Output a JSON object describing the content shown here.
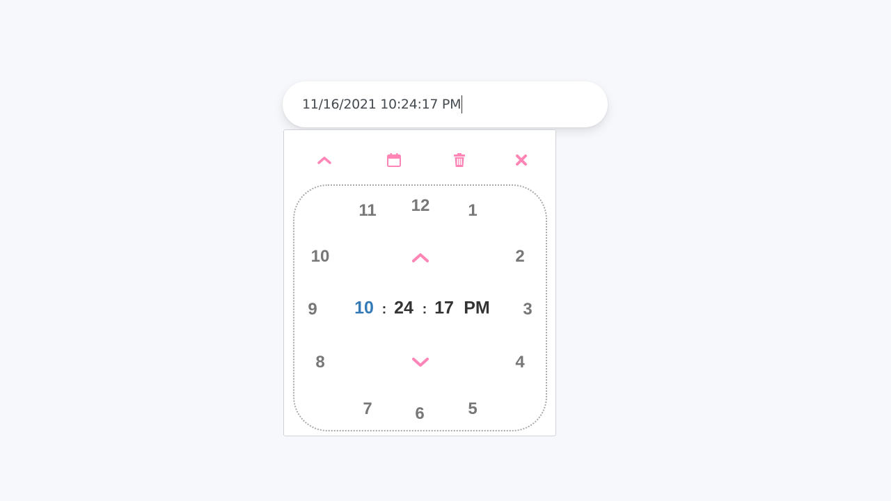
{
  "input": {
    "value": "11/16/2021 10:24:17 PM"
  },
  "colors": {
    "accent": "#ff85b6",
    "selected": "#337ab7",
    "hour_text": "#777777",
    "time_text": "#333333"
  },
  "toolbar": {
    "items": [
      {
        "icon": "chevron-up-icon"
      },
      {
        "icon": "calendar-icon"
      },
      {
        "icon": "trash-icon"
      },
      {
        "icon": "close-icon"
      }
    ]
  },
  "clock": {
    "hours": [
      "12",
      "1",
      "2",
      "3",
      "4",
      "5",
      "6",
      "7",
      "8",
      "9",
      "10",
      "11"
    ]
  },
  "time": {
    "hour": "10",
    "minute": "24",
    "second": "17",
    "period": "PM",
    "separator": ":"
  }
}
